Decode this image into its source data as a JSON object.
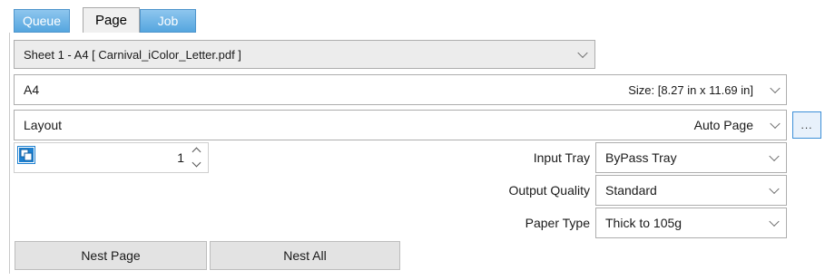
{
  "tabs": [
    {
      "label": "Queue",
      "active": false
    },
    {
      "label": "Page",
      "active": true
    },
    {
      "label": "Job",
      "active": false
    }
  ],
  "sheet_select": {
    "value": "Sheet 1 - A4 [ Carnival_iColor_Letter.pdf ]"
  },
  "size_select": {
    "name": "A4",
    "value": "Size: [8.27 in x 11.69 in]"
  },
  "layout_select": {
    "label": "Layout",
    "value": "Auto Page",
    "more_label": "..."
  },
  "copies": {
    "value": "1"
  },
  "input_tray": {
    "label": "Input Tray",
    "value": "ByPass Tray"
  },
  "output_quality": {
    "label": "Output Quality",
    "value": "Standard"
  },
  "paper_type": {
    "label": "Paper Type",
    "value": "Thick to 105g"
  },
  "buttons": {
    "nest_page": "Nest Page",
    "nest_all": "Nest All"
  },
  "colors": {
    "tab_blue": "#55a6df",
    "accent_blue": "#1d80d0"
  }
}
